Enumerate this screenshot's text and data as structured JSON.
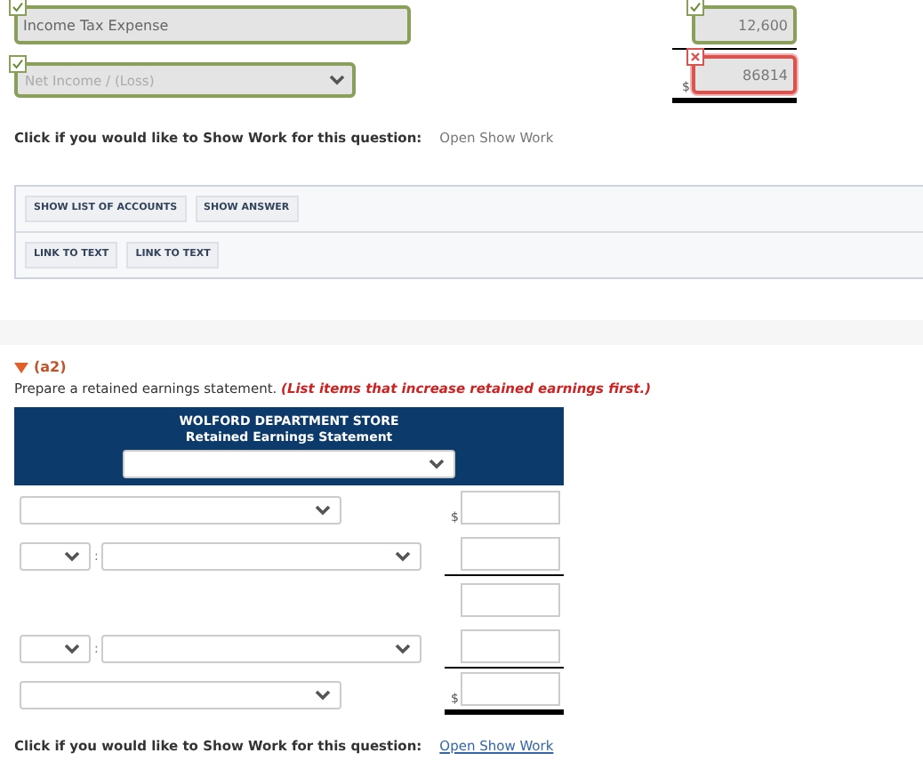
{
  "income_rows": [
    {
      "kind": "text_field",
      "value": "Income Tax Expense",
      "correct": true,
      "amount": "12,600",
      "amount_correct": true,
      "underline": true,
      "double": false
    },
    {
      "kind": "dropdown",
      "value": "Net Income / (Loss)",
      "correct": true,
      "currency": "$",
      "amount": "86814",
      "amount_correct": false,
      "underline": true,
      "double": true
    }
  ],
  "show_work_top": {
    "prompt": "Click if you would like to Show Work for this question:",
    "link": "Open Show Work",
    "disabled": true
  },
  "button_rows": [
    [
      {
        "label": "SHOW LIST OF ACCOUNTS"
      },
      {
        "label": "SHOW ANSWER"
      }
    ],
    [
      {
        "label": "LINK TO TEXT"
      },
      {
        "label": "LINK TO TEXT"
      }
    ]
  ],
  "section": {
    "label": "(a2)",
    "expanded": true,
    "instruction": "Prepare a retained earnings statement. *(List items that increase retained earnings first.)*"
  },
  "statement": {
    "company": "WOLFORD DEPARTMENT STORE",
    "title": "Retained Earnings Statement",
    "rows": [
      {
        "kind": "account",
        "currency": "$"
      },
      {
        "kind": "adjusted",
        "separator": ":",
        "underline": true,
        "double": false
      },
      {
        "kind": "blank"
      },
      {
        "kind": "adjusted",
        "separator": ":",
        "underline": true,
        "double": false
      },
      {
        "kind": "account",
        "currency": "$",
        "underline": true,
        "double": true
      }
    ]
  },
  "show_work_bottom": {
    "prompt": "Click if you would like to Show Work for this question:",
    "link": "Open Show Work",
    "disabled": false
  }
}
